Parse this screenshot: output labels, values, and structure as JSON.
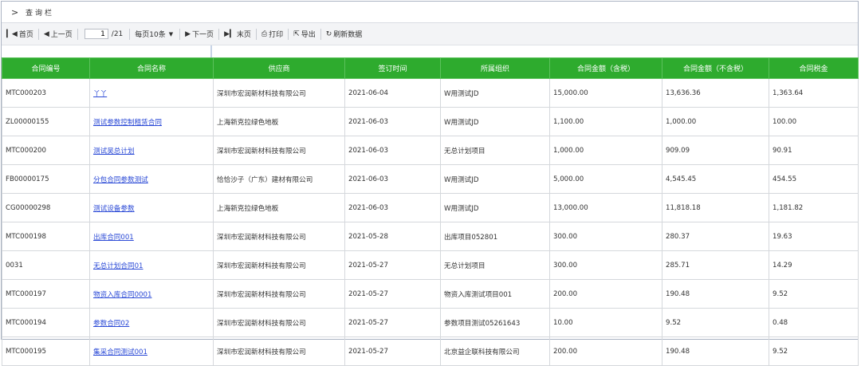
{
  "querybar": {
    "chevron": ">",
    "title": "查询栏"
  },
  "toolbar": {
    "first": "首页",
    "prev": "上一页",
    "page_value": "1",
    "page_total": "/21",
    "page_size": "每页10条",
    "next": "下一页",
    "last": "末页",
    "print": "打印",
    "export": "导出",
    "refresh": "刷新数据"
  },
  "table": {
    "headers": [
      "合同编号",
      "合同名称",
      "供应商",
      "签订时间",
      "所属组织",
      "合同金额（含税）",
      "合同金额（不含税）",
      "合同税金"
    ],
    "rows": [
      [
        "MTC000203",
        "丫丫",
        "深圳市宏润新材科技有限公司",
        "2021-06-04",
        "W用测试JD",
        "15,000.00",
        "13,636.36",
        "1,363.64"
      ],
      [
        "ZL00000155",
        "测试参数控制租赁合同",
        "上海新克拉绿色地板",
        "2021-06-03",
        "W用测试JD",
        "1,100.00",
        "1,000.00",
        "100.00"
      ],
      [
        "MTC000200",
        "测试吴总计划",
        "深圳市宏润新材科技有限公司",
        "2021-06-03",
        "无总计划项目",
        "1,000.00",
        "909.09",
        "90.91"
      ],
      [
        "FB00000175",
        "分包合同参数测试",
        "恰恰沙子（广东）建材有限公司",
        "2021-06-03",
        "W用测试JD",
        "5,000.00",
        "4,545.45",
        "454.55"
      ],
      [
        "CG00000298",
        "测试设备参数",
        "上海新克拉绿色地板",
        "2021-06-03",
        "W用测试JD",
        "13,000.00",
        "11,818.18",
        "1,181.82"
      ],
      [
        "MTC000198",
        "出库合同001",
        "深圳市宏润新材科技有限公司",
        "2021-05-28",
        "出库项目052801",
        "300.00",
        "280.37",
        "19.63"
      ],
      [
        "0031",
        "无总计划合同01",
        "深圳市宏润新材科技有限公司",
        "2021-05-27",
        "无总计划项目",
        "300.00",
        "285.71",
        "14.29"
      ],
      [
        "MTC000197",
        "物资入库合同0001",
        "深圳市宏润新材科技有限公司",
        "2021-05-27",
        "物资入库测试项目001",
        "200.00",
        "190.48",
        "9.52"
      ],
      [
        "MTC000194",
        "参数合同02",
        "深圳市宏润新材科技有限公司",
        "2021-05-27",
        "参数项目测试05261643",
        "10.00",
        "9.52",
        "0.48"
      ],
      [
        "MTC000195",
        "集采合同测试001",
        "深圳市宏润新材科技有限公司",
        "2021-05-27",
        "北京益企联科技有限公司",
        "200.00",
        "190.48",
        "9.52"
      ]
    ]
  },
  "colors": {
    "header_green": "#2eab2e",
    "link_blue": "#2a49d6"
  }
}
